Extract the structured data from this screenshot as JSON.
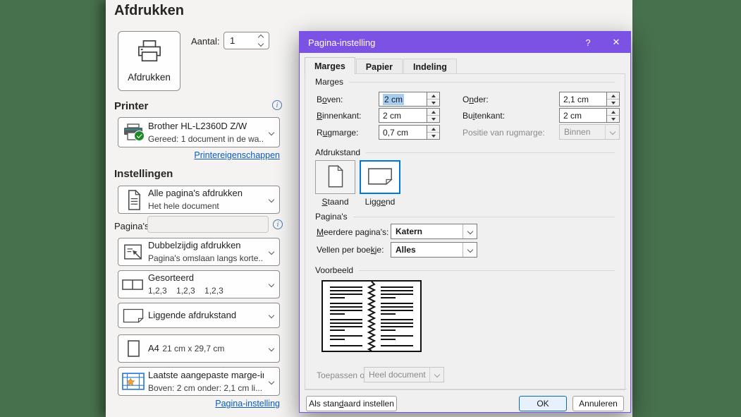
{
  "colors": {
    "accent_purple": "#7b52e3",
    "backstage_green": "#47704c",
    "selection_blue": "#a6cdf0",
    "selected_tile_blue": "#0078d7",
    "link_blue": "#0b5cbd"
  },
  "icons": {
    "info_glyph": "i"
  },
  "backstage": {
    "title": "Afdrukken",
    "print_button_label": "Afdrukken",
    "copies": {
      "label": "Aantal:",
      "value": "1"
    },
    "printer": {
      "heading": "Printer",
      "name": "Brother HL-L2360D Z/W",
      "status": "Gereed: 1 document in de wa...",
      "properties_link": "Printereigenschappen"
    },
    "settings_heading": "Instellingen",
    "pages": {
      "label": "Pagina's:",
      "value": ""
    },
    "dropdowns": [
      {
        "title": "Alle pagina's afdrukken",
        "subtitle": "Het hele document"
      },
      {
        "title": "Dubbelzijdig afdrukken",
        "subtitle": "Pagina's omslaan langs korte..."
      },
      {
        "title": "Gesorteerd",
        "subtitle": "1,2,3    1,2,3    1,2,3"
      },
      {
        "title": "Liggende afdrukstand",
        "subtitle": ""
      },
      {
        "title": "A4",
        "subtitle": "21 cm x 29,7 cm"
      },
      {
        "title": "Laatste aangepaste marge-in...",
        "subtitle": "Boven: 2 cm onder: 2,1 cm li..."
      }
    ],
    "page_setup_link": "Pagina-instelling"
  },
  "dialog": {
    "title": "Pagina-instelling",
    "help_button": "?",
    "close_button": "✕",
    "tabs": [
      {
        "label": "Marges"
      },
      {
        "label": "Papier"
      },
      {
        "label": "Indeling"
      }
    ],
    "active_tab": "Marges",
    "margins": {
      "heading": "Marges",
      "boven": {
        "pre": "B",
        "accel": "o",
        "post": "ven:",
        "value": "2 cm"
      },
      "onder": {
        "pre": "O",
        "accel": "n",
        "post": "der:",
        "value": "2,1 cm"
      },
      "binnenkant": {
        "pre": "",
        "accel": "B",
        "post": "innenkant:",
        "value": "2 cm"
      },
      "buitenkant": {
        "pre": "Bu",
        "accel": "i",
        "post": "tenkant:",
        "value": "2 cm"
      },
      "rugmarge": {
        "pre": "R",
        "accel": "u",
        "post": "gmarge:",
        "value": "0,7 cm"
      },
      "positie": {
        "label": "Positie van rugmarge:",
        "value": "Binnen"
      }
    },
    "orientation": {
      "heading": "Afdrukstand",
      "staand": {
        "pre": "",
        "accel": "S",
        "post": "taand"
      },
      "liggend": {
        "pre": "Ligg",
        "accel": "e",
        "post": "nd"
      },
      "selected": "Liggend"
    },
    "pages": {
      "heading": "Pagina's",
      "meerdere": {
        "pre": "",
        "accel": "M",
        "post": "eerdere pagina's:",
        "value": "Katern"
      },
      "vellen": {
        "pre": "Vellen per boe",
        "accel": "k",
        "post": "je:",
        "value": "Alles"
      }
    },
    "preview": {
      "heading": "Voorbeeld"
    },
    "apply_to": {
      "label": "Toepassen op:",
      "value": "Heel document"
    },
    "buttons": {
      "set_default": {
        "pre": "Als stan",
        "accel": "d",
        "post": "aard instellen"
      },
      "ok": "OK",
      "cancel": "Annuleren"
    }
  }
}
